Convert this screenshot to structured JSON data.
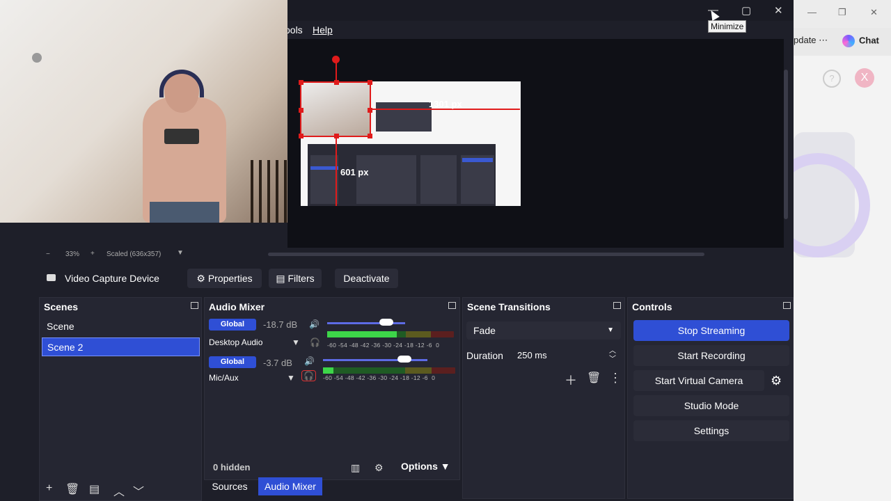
{
  "window": {
    "menu": [
      "ools",
      "Help"
    ],
    "tooltip": "Minimize"
  },
  "background_app": {
    "update_label": "pdate ⋯",
    "chat_label": "Chat",
    "help_glyph": "?",
    "close_glyph": "X"
  },
  "preview": {
    "width_label": "1301 px",
    "height_label": "601 px",
    "zoom_out": "−",
    "zoom_percent": "33%",
    "zoom_in": "+",
    "scale_text": "Scaled (636x357)"
  },
  "source_toolbar": {
    "source_name": "Video Capture Device",
    "properties_label": "Properties",
    "filters_label": "Filters",
    "deactivate_label": "Deactivate"
  },
  "scenes": {
    "title": "Scenes",
    "items": [
      "Scene",
      "Scene 2"
    ],
    "selected": "Scene 2"
  },
  "audio_mixer": {
    "title": "Audio Mixer",
    "channels": [
      {
        "global": "Global",
        "db": "-18.7 dB",
        "name": "Desktop Audio",
        "level": 0.55,
        "volume": 0.76
      },
      {
        "global": "Global",
        "db": "-3.7 dB",
        "name": "Mic/Aux",
        "level": 0.08,
        "volume": 0.78
      }
    ],
    "ticks": "-60 -54 -48 -42 -36 -30 -24 -18 -12 -6  0",
    "hidden_label": "0 hidden",
    "options_label": "Options"
  },
  "bottom_tabs": {
    "sources": "Sources",
    "audio_mixer": "Audio Mixer"
  },
  "scene_transitions": {
    "title": "Scene Transitions",
    "transition": "Fade",
    "duration_label": "Duration",
    "duration_value": "250 ms"
  },
  "controls": {
    "title": "Controls",
    "stop_streaming": "Stop Streaming",
    "start_recording": "Start Recording",
    "start_virtual_camera": "Start Virtual Camera",
    "studio_mode": "Studio Mode",
    "settings": "Settings"
  }
}
